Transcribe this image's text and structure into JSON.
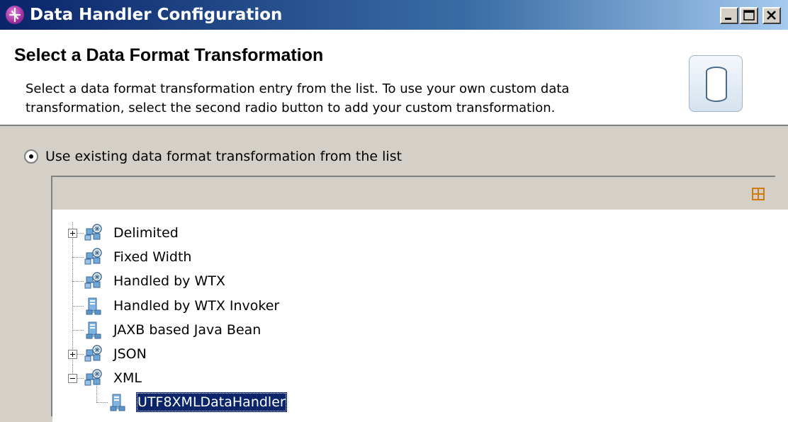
{
  "window": {
    "title": "Data Handler Configuration",
    "buttons": [
      "minimize",
      "maximize",
      "close"
    ]
  },
  "banner": {
    "title": "Select a Data Format Transformation",
    "description": "Select a data format transformation entry from the list.  To use your own custom data transformation, select the second radio button to add your custom transformation.",
    "icon": "database-icon"
  },
  "option": {
    "label": "Use existing data format transformation from the list",
    "selected": true
  },
  "toolbar": {
    "icon": "expand-all-icon"
  },
  "tree": {
    "items": [
      {
        "label": "Delimited",
        "icon": "transform-folder-icon",
        "expander": "plus"
      },
      {
        "label": "Fixed Width",
        "icon": "transform-folder-icon",
        "expander": ""
      },
      {
        "label": "Handled by WTX",
        "icon": "transform-folder-icon",
        "expander": ""
      },
      {
        "label": "Handled by WTX Invoker",
        "icon": "data-handler-icon",
        "expander": ""
      },
      {
        "label": "JAXB based Java Bean",
        "icon": "data-handler-icon",
        "expander": ""
      },
      {
        "label": "JSON",
        "icon": "transform-folder-icon",
        "expander": "plus"
      },
      {
        "label": "XML",
        "icon": "transform-folder-icon",
        "expander": "minus"
      },
      {
        "label": "UTF8XMLDataHandler",
        "icon": "data-handler-icon",
        "expander": "",
        "selected": true
      }
    ]
  },
  "colors": {
    "selection": "#0a246a",
    "title_bar_start": "#0a246a",
    "title_bar_end": "#a6caf0",
    "dialog_bg": "#d4d0c8"
  }
}
